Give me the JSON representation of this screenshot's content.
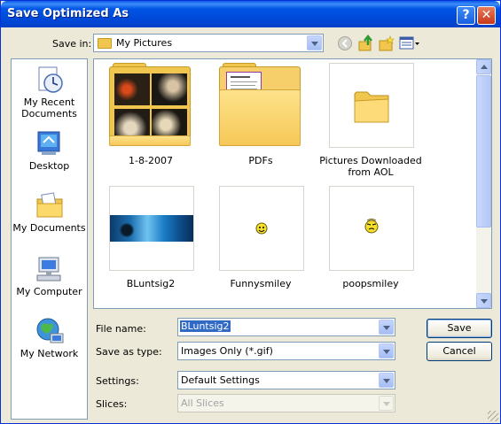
{
  "window": {
    "title": "Save Optimized As"
  },
  "titlebar": {
    "help_label": "?",
    "close_label": "✕"
  },
  "save_in": {
    "label": "Save in:",
    "value": "My Pictures"
  },
  "places": [
    {
      "label": "My Recent\nDocuments",
      "icon": "recent-documents-icon"
    },
    {
      "label": "Desktop",
      "icon": "desktop-icon"
    },
    {
      "label": "My Documents",
      "icon": "my-documents-icon"
    },
    {
      "label": "My Computer",
      "icon": "my-computer-icon"
    },
    {
      "label": "My Network",
      "icon": "my-network-icon"
    }
  ],
  "files": [
    {
      "name": "1-8-2007",
      "kind": "folder-photos"
    },
    {
      "name": "PDFs",
      "kind": "folder-doc"
    },
    {
      "name": "Pictures Downloaded\nfrom AOL",
      "kind": "folder-empty"
    },
    {
      "name": "BLuntsig2",
      "kind": "image-banner"
    },
    {
      "name": "Funnysmiley",
      "kind": "image-smiley"
    },
    {
      "name": "poopsmiley",
      "kind": "image-smiley"
    }
  ],
  "form": {
    "file_name_label": "File name:",
    "file_name_value": "BLuntsig2",
    "save_as_type_label": "Save as type:",
    "save_as_type_value": "Images Only (*.gif)",
    "settings_label": "Settings:",
    "settings_value": "Default Settings",
    "slices_label": "Slices:",
    "slices_value": "All Slices"
  },
  "buttons": {
    "save": "Save",
    "cancel": "Cancel"
  },
  "colors": {
    "titlebar": "#0055e5",
    "window_bg": "#ece9d8",
    "folder": "#f6c858"
  }
}
